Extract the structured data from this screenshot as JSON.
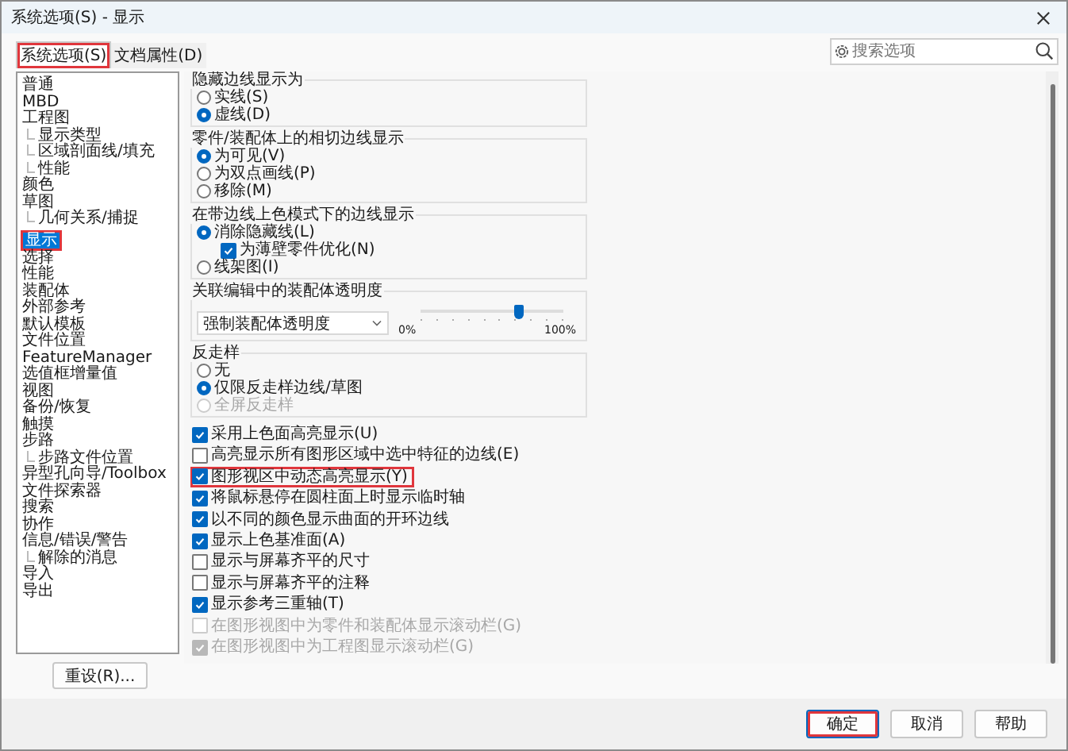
{
  "window": {
    "title": "系统选项(S) - 显示"
  },
  "tabs": [
    {
      "label": "系统选项(S)",
      "selected": true,
      "highlighted": true
    },
    {
      "label": "文档属性(D)",
      "selected": false,
      "highlighted": false
    }
  ],
  "search": {
    "placeholder": "搜索选项"
  },
  "sidebar": {
    "items": [
      {
        "label": "普通",
        "selected": false,
        "highlighted": false
      },
      {
        "label": "MBD",
        "selected": false,
        "highlighted": false
      },
      {
        "label": "工程图",
        "selected": false,
        "highlighted": false,
        "children": [
          {
            "label": "显示类型",
            "selected": false,
            "highlighted": false
          },
          {
            "label": "区域剖面线/填充",
            "selected": false,
            "highlighted": false
          },
          {
            "label": "性能",
            "selected": false,
            "highlighted": false
          }
        ]
      },
      {
        "label": "颜色",
        "selected": false,
        "highlighted": false
      },
      {
        "label": "草图",
        "selected": false,
        "highlighted": false,
        "children": [
          {
            "label": "几何关系/捕捉",
            "selected": false,
            "highlighted": false
          }
        ]
      },
      {
        "label": "显示",
        "selected": true,
        "highlighted": true
      },
      {
        "label": "选择",
        "selected": false,
        "highlighted": false
      },
      {
        "label": "性能",
        "selected": false,
        "highlighted": false
      },
      {
        "label": "装配体",
        "selected": false,
        "highlighted": false
      },
      {
        "label": "外部参考",
        "selected": false,
        "highlighted": false
      },
      {
        "label": "默认模板",
        "selected": false,
        "highlighted": false
      },
      {
        "label": "文件位置",
        "selected": false,
        "highlighted": false
      },
      {
        "label": "FeatureManager",
        "selected": false,
        "highlighted": false
      },
      {
        "label": "选值框增量值",
        "selected": false,
        "highlighted": false
      },
      {
        "label": "视图",
        "selected": false,
        "highlighted": false
      },
      {
        "label": "备份/恢复",
        "selected": false,
        "highlighted": false
      },
      {
        "label": "触摸",
        "selected": false,
        "highlighted": false
      },
      {
        "label": "步路",
        "selected": false,
        "highlighted": false,
        "children": [
          {
            "label": "步路文件位置",
            "selected": false,
            "highlighted": false
          }
        ]
      },
      {
        "label": "异型孔向导/Toolbox",
        "selected": false,
        "highlighted": false
      },
      {
        "label": "文件探索器",
        "selected": false,
        "highlighted": false
      },
      {
        "label": "搜索",
        "selected": false,
        "highlighted": false
      },
      {
        "label": "协作",
        "selected": false,
        "highlighted": false
      },
      {
        "label": "信息/错误/警告",
        "selected": false,
        "highlighted": false,
        "children": [
          {
            "label": "解除的消息",
            "selected": false,
            "highlighted": false
          }
        ]
      },
      {
        "label": "导入",
        "selected": false,
        "highlighted": false
      },
      {
        "label": "导出",
        "selected": false,
        "highlighted": false
      }
    ]
  },
  "reset_button": "重设(R)...",
  "groups": [
    {
      "title": "隐藏边线显示为",
      "options": [
        {
          "kind": "radio",
          "label": "实线(S)",
          "selected": false,
          "disabled": false
        },
        {
          "kind": "radio",
          "label": "虚线(D)",
          "selected": true,
          "disabled": false
        }
      ]
    },
    {
      "title": "零件/装配体上的相切边线显示",
      "options": [
        {
          "kind": "radio",
          "label": "为可见(V)",
          "selected": true,
          "disabled": false
        },
        {
          "kind": "radio",
          "label": "为双点画线(P)",
          "selected": false,
          "disabled": false
        },
        {
          "kind": "radio",
          "label": "移除(M)",
          "selected": false,
          "disabled": false
        }
      ]
    },
    {
      "title": "在带边线上色模式下的边线显示",
      "options": [
        {
          "kind": "radio",
          "label": "消除隐藏线(L)",
          "selected": true,
          "disabled": false,
          "children": [
            {
              "kind": "checkbox",
              "label": "为薄壁零件优化(N)",
              "checked": true,
              "disabled": false
            }
          ]
        },
        {
          "kind": "radio",
          "label": "线架图(I)",
          "selected": false,
          "disabled": false
        }
      ]
    },
    {
      "title": "关联编辑中的装配体透明度",
      "options": [
        {
          "kind": "transparency",
          "value": "强制装配体透明度",
          "min_label": "0%",
          "max_label": "100%",
          "level": 0.68
        }
      ]
    },
    {
      "title": "反走样",
      "options": [
        {
          "kind": "radio",
          "label": "无",
          "selected": false,
          "disabled": false
        },
        {
          "kind": "radio",
          "label": "仅限反走样边线/草图",
          "selected": true,
          "disabled": false
        },
        {
          "kind": "radio",
          "label": "全屏反走样",
          "selected": false,
          "disabled": true
        }
      ]
    }
  ],
  "checkboxes": [
    {
      "label": "采用上色面高亮显示(U)",
      "checked": true,
      "disabled": false,
      "highlighted": false
    },
    {
      "label": "高亮显示所有图形区域中选中特征的边线(E)",
      "checked": false,
      "disabled": false,
      "highlighted": false
    },
    {
      "label": "图形视区中动态高亮显示(Y)",
      "checked": true,
      "disabled": false,
      "highlighted": true
    },
    {
      "label": "将鼠标悬停在圆柱面上时显示临时轴",
      "checked": true,
      "disabled": false,
      "highlighted": false
    },
    {
      "label": "以不同的颜色显示曲面的开环边线",
      "checked": true,
      "disabled": false,
      "highlighted": false
    },
    {
      "label": "显示上色基准面(A)",
      "checked": true,
      "disabled": false,
      "highlighted": false
    },
    {
      "label": "显示与屏幕齐平的尺寸",
      "checked": false,
      "disabled": false,
      "highlighted": false
    },
    {
      "label": "显示与屏幕齐平的注释",
      "checked": false,
      "disabled": false,
      "highlighted": false
    },
    {
      "label": "显示参考三重轴(T)",
      "checked": true,
      "disabled": false,
      "highlighted": false
    },
    {
      "label": "在图形视图中为零件和装配体显示滚动栏(G)",
      "checked": false,
      "disabled": true,
      "highlighted": false
    },
    {
      "label": "在图形视图中为工程图显示滚动栏(G)",
      "checked": true,
      "disabled": true,
      "highlighted": false
    }
  ],
  "buttons": [
    {
      "label": "确定",
      "default": true,
      "highlighted": true
    },
    {
      "label": "取消",
      "default": false,
      "highlighted": false
    },
    {
      "label": "帮助",
      "default": false,
      "highlighted": false
    }
  ]
}
